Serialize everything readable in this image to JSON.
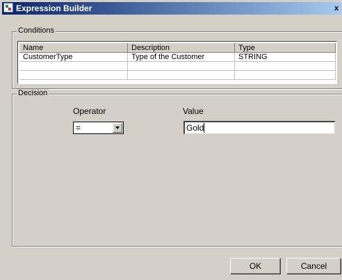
{
  "window": {
    "title": "Expression Builder",
    "close_label": "x"
  },
  "conditions": {
    "group_label": "Conditions",
    "columns": [
      "Name",
      "Description",
      "Type"
    ],
    "rows": [
      [
        "CustomerType",
        "Type of the Customer",
        "STRING"
      ],
      [
        "",
        "",
        ""
      ],
      [
        "",
        "",
        ""
      ]
    ]
  },
  "decision": {
    "group_label": "Decision",
    "operator_label": "Operator",
    "operator_value": "=",
    "value_label": "Value",
    "value_text": "Gold"
  },
  "buttons": {
    "ok": "OK",
    "cancel": "Cancel"
  }
}
